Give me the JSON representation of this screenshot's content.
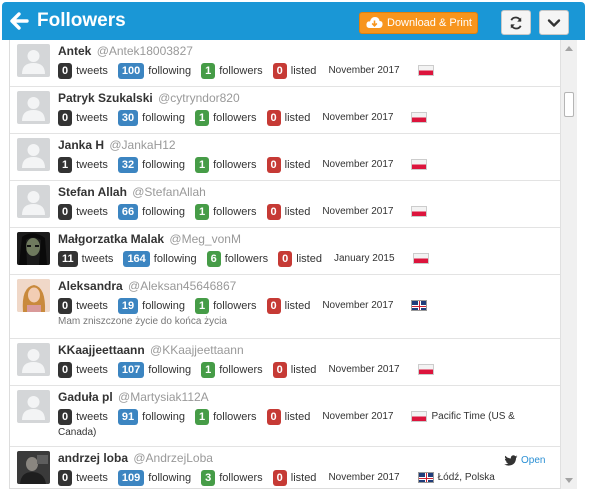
{
  "header": {
    "title": "Followers",
    "download_label": "Download & Print"
  },
  "labels": {
    "tweets": "tweets",
    "following": "following",
    "followers": "followers",
    "listed": "listed",
    "open": "Open"
  },
  "colors": {
    "header_bg": "#1a97d6",
    "download_bg": "#f7951d",
    "badge_tweets": "#333333",
    "badge_following": "#3c85c1",
    "badge_followers": "#469c47",
    "badge_listed": "#c63a35"
  },
  "followers": [
    {
      "name": "Antek",
      "handle": "@Antek18003827",
      "tweets": "0",
      "following": "100",
      "followers": "1",
      "listed": "0",
      "date": "November 2017",
      "flag": "pl",
      "location": "",
      "bio": "",
      "avatar": "default"
    },
    {
      "name": "Patryk Szukalski",
      "handle": "@cytryndor820",
      "tweets": "0",
      "following": "30",
      "followers": "1",
      "listed": "0",
      "date": "November 2017",
      "flag": "pl",
      "location": "",
      "bio": "",
      "avatar": "default"
    },
    {
      "name": "Janka H",
      "handle": "@JankaH12",
      "tweets": "1",
      "following": "32",
      "followers": "1",
      "listed": "0",
      "date": "November 2017",
      "flag": "pl",
      "location": "",
      "bio": "",
      "avatar": "default"
    },
    {
      "name": "Stefan Allah",
      "handle": "@StefanAllah",
      "tweets": "0",
      "following": "66",
      "followers": "1",
      "listed": "0",
      "date": "November 2017",
      "flag": "pl",
      "location": "",
      "bio": "",
      "avatar": "default"
    },
    {
      "name": "Małgorzatka Malak",
      "handle": "@Meg_vonM",
      "tweets": "11",
      "following": "164",
      "followers": "6",
      "listed": "0",
      "date": "January 2015",
      "flag": "pl",
      "location": "",
      "bio": "",
      "avatar": "dark"
    },
    {
      "name": "Aleksandra",
      "handle": "@Aleksan45646867",
      "tweets": "0",
      "following": "19",
      "followers": "1",
      "listed": "0",
      "date": "November 2017",
      "flag": "uk",
      "location": "",
      "bio": "Mam zniszczone życie do końca życia",
      "avatar": "girl"
    },
    {
      "name": "KKaajjeettaann",
      "handle": "@KKaajjeettaann",
      "tweets": "0",
      "following": "107",
      "followers": "1",
      "listed": "0",
      "date": "November 2017",
      "flag": "pl",
      "location": "",
      "bio": "",
      "avatar": "default"
    },
    {
      "name": "Gaduła pl",
      "handle": "@Martysiak112A",
      "tweets": "0",
      "following": "91",
      "followers": "1",
      "listed": "0",
      "date": "November 2017",
      "flag": "pl",
      "location": "Pacific Time (US &",
      "location_cont": "Canada)",
      "bio": "",
      "avatar": "default"
    },
    {
      "name": "andrzej loba",
      "handle": "@AndrzejLoba",
      "tweets": "0",
      "following": "109",
      "followers": "3",
      "listed": "0",
      "date": "November 2017",
      "flag": "uk",
      "location": "Łódź, Polska",
      "bio": "",
      "avatar": "photo",
      "open": true
    }
  ]
}
